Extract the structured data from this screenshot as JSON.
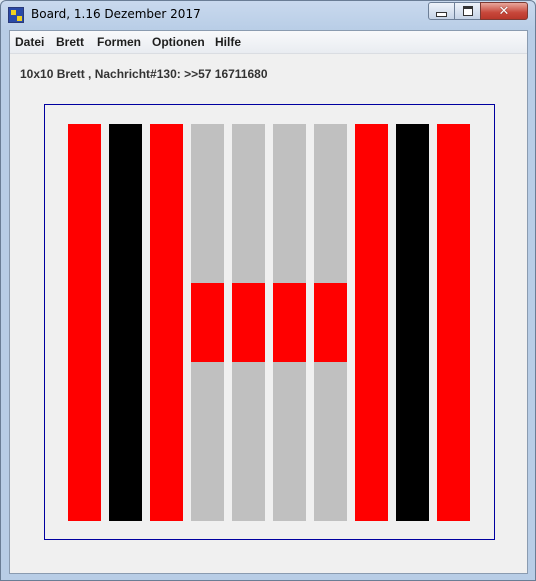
{
  "window": {
    "title": "Board, 1.16 Dezember 2017",
    "controls": [
      "minimize",
      "maximize",
      "close"
    ]
  },
  "menu": {
    "items": [
      {
        "label": "Datei"
      },
      {
        "label": "Brett"
      },
      {
        "label": "Formen"
      },
      {
        "label": "Optionen"
      },
      {
        "label": "Hilfe"
      }
    ]
  },
  "status": {
    "text": "10x10 Brett , Nachricht#130: >>57 16711680"
  },
  "board": {
    "size": "10x10",
    "colors": {
      "red": "#ff0000",
      "black": "#000000",
      "gray": "#c0c0c0",
      "border": "#0000a0",
      "background": "#f0f0f0"
    },
    "columns": [
      [
        "red",
        "red",
        "red",
        "red",
        "red",
        "red",
        "red",
        "red",
        "red",
        "red"
      ],
      [
        "black",
        "black",
        "black",
        "black",
        "black",
        "black",
        "black",
        "black",
        "black",
        "black"
      ],
      [
        "red",
        "red",
        "red",
        "red",
        "red",
        "red",
        "red",
        "red",
        "red",
        "red"
      ],
      [
        "gray",
        "gray",
        "gray",
        "gray",
        "red",
        "red",
        "gray",
        "gray",
        "gray",
        "gray"
      ],
      [
        "gray",
        "gray",
        "gray",
        "gray",
        "red",
        "red",
        "gray",
        "gray",
        "gray",
        "gray"
      ],
      [
        "gray",
        "gray",
        "gray",
        "gray",
        "red",
        "red",
        "gray",
        "gray",
        "gray",
        "gray"
      ],
      [
        "gray",
        "gray",
        "gray",
        "gray",
        "red",
        "red",
        "gray",
        "gray",
        "gray",
        "gray"
      ],
      [
        "red",
        "red",
        "red",
        "red",
        "red",
        "red",
        "red",
        "red",
        "red",
        "red"
      ],
      [
        "black",
        "black",
        "black",
        "black",
        "black",
        "black",
        "black",
        "black",
        "black",
        "black"
      ],
      [
        "red",
        "red",
        "red",
        "red",
        "red",
        "red",
        "red",
        "red",
        "red",
        "red"
      ]
    ]
  }
}
